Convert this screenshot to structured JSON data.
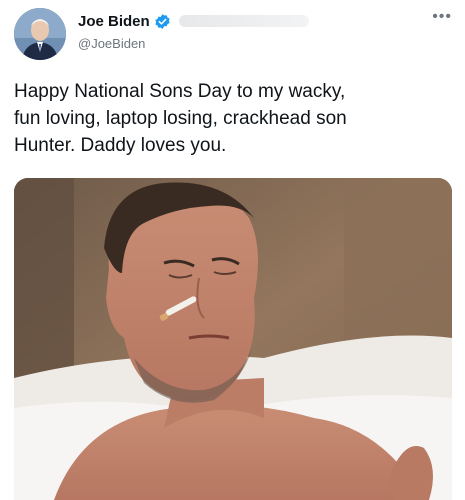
{
  "author": {
    "display_name": "Joe Biden",
    "handle": "@JoeBiden",
    "verified": true,
    "avatar_icon": "profile-photo",
    "verified_icon": "verified-badge-icon",
    "more_icon": "more-options-icon"
  },
  "tweet": {
    "text": "Happy National Sons Day to my wacky,\nfun loving, laptop losing, crackhead son\nHunter. Daddy loves you."
  },
  "media": {
    "type": "photo"
  },
  "colors": {
    "verified_badge": "#1d9bf0",
    "secondary_text": "#6e767d",
    "primary_text": "#0f1419"
  }
}
